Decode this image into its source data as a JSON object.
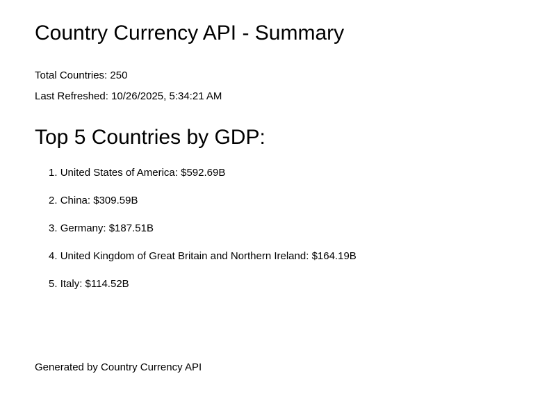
{
  "page": {
    "title": "Country Currency API - Summary"
  },
  "meta": {
    "total_label": "Total Countries:",
    "total_value": "250",
    "refreshed_label": "Last Refreshed:",
    "refreshed_value": "10/26/2025, 5:34:21 AM"
  },
  "top_gdp": {
    "heading": "Top 5 Countries by GDP:",
    "items": [
      {
        "rank": "1.",
        "country": "United States of America",
        "gdp": "$592.69B"
      },
      {
        "rank": "2.",
        "country": "China",
        "gdp": "$309.59B"
      },
      {
        "rank": "3.",
        "country": "Germany",
        "gdp": "$187.51B"
      },
      {
        "rank": "4.",
        "country": "United Kingdom of Great Britain and Northern Ireland",
        "gdp": "$164.19B"
      },
      {
        "rank": "5.",
        "country": "Italy",
        "gdp": "$114.52B"
      }
    ]
  },
  "footer": {
    "text": "Generated by Country Currency API"
  }
}
